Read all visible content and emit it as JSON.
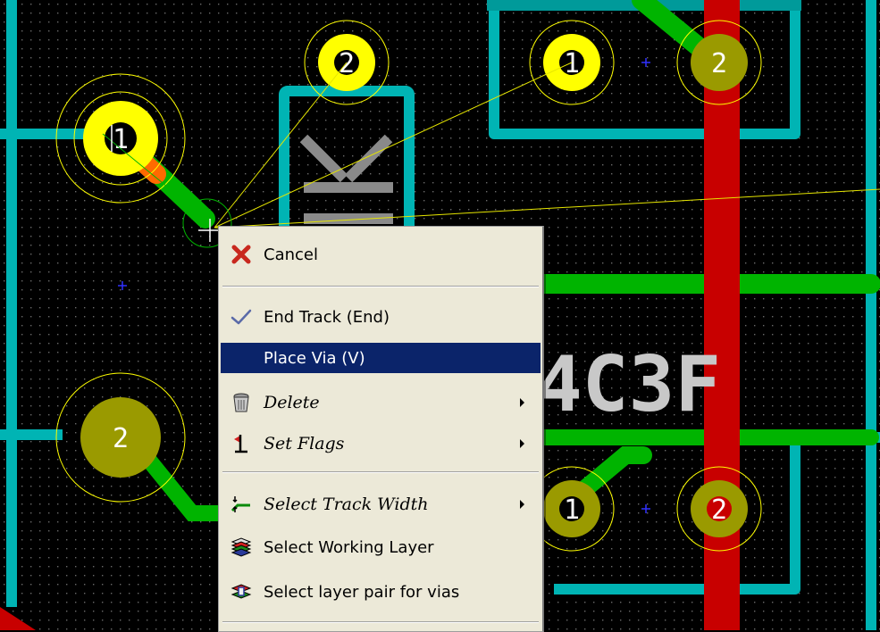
{
  "pcb": {
    "background": "#000000",
    "track_color": "#00c0c0",
    "trace_green": "#00c000",
    "pad_yellow": "#ffff00",
    "via_red": "#c00000",
    "pad_labels": {
      "left_top": "1",
      "top_center": "2",
      "top_right_a": "1",
      "top_right_b": "2",
      "left_mid": "2",
      "bottom_a": "1",
      "bottom_b": "2"
    },
    "silk_ref": "4C3F"
  },
  "context_menu": {
    "items": [
      {
        "label": "Cancel",
        "icon": "red-x-icon"
      },
      {
        "label": "End Track (End)",
        "icon": "checkmark-icon"
      },
      {
        "label": "Place Via (V)",
        "icon": "",
        "highlighted": true
      },
      {
        "label": "Delete",
        "icon": "trash-can-icon",
        "submenu": true
      },
      {
        "label": "Set Flags",
        "icon": "flag-icon",
        "submenu": true
      },
      {
        "label": "Select Track Width",
        "icon": "track-width-icon",
        "submenu": true
      },
      {
        "label": "Select Working Layer",
        "icon": "layers-icon"
      },
      {
        "label": "Select layer pair for vias",
        "icon": "layer-pair-icon"
      }
    ],
    "highlight_color": "#0b246a"
  }
}
